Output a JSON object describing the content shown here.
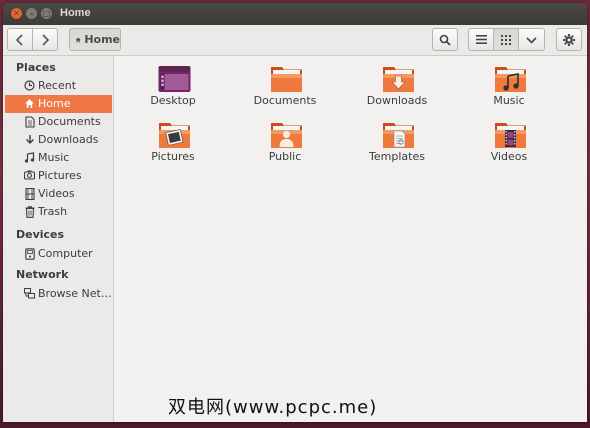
{
  "window": {
    "title": "Home"
  },
  "toolbar": {
    "location_label": "Home"
  },
  "sidebar": {
    "sections": {
      "places": "Places",
      "devices": "Devices",
      "network": "Network"
    },
    "places": [
      {
        "label": "Recent",
        "icon": "clock-icon"
      },
      {
        "label": "Home",
        "icon": "home-icon",
        "active": true
      },
      {
        "label": "Documents",
        "icon": "document-icon"
      },
      {
        "label": "Downloads",
        "icon": "download-icon"
      },
      {
        "label": "Music",
        "icon": "music-icon"
      },
      {
        "label": "Pictures",
        "icon": "camera-icon"
      },
      {
        "label": "Videos",
        "icon": "film-icon"
      },
      {
        "label": "Trash",
        "icon": "trash-icon"
      }
    ],
    "devices": [
      {
        "label": "Computer",
        "icon": "drive-icon"
      }
    ],
    "network": [
      {
        "label": "Browse Net…",
        "icon": "network-icon"
      }
    ]
  },
  "files": [
    {
      "label": "Desktop",
      "icon": "desktop-folder-icon"
    },
    {
      "label": "Documents",
      "icon": "documents-folder-icon"
    },
    {
      "label": "Downloads",
      "icon": "downloads-folder-icon"
    },
    {
      "label": "Music",
      "icon": "music-folder-icon"
    },
    {
      "label": "Pictures",
      "icon": "pictures-folder-icon"
    },
    {
      "label": "Public",
      "icon": "public-folder-icon"
    },
    {
      "label": "Templates",
      "icon": "templates-folder-icon"
    },
    {
      "label": "Videos",
      "icon": "videos-folder-icon"
    }
  ],
  "watermark": "双电网(www.pcpc.me)",
  "colors": {
    "accent": "#f07746",
    "titlebar": "#3c3b37",
    "folder_orange": "#e96b34"
  }
}
